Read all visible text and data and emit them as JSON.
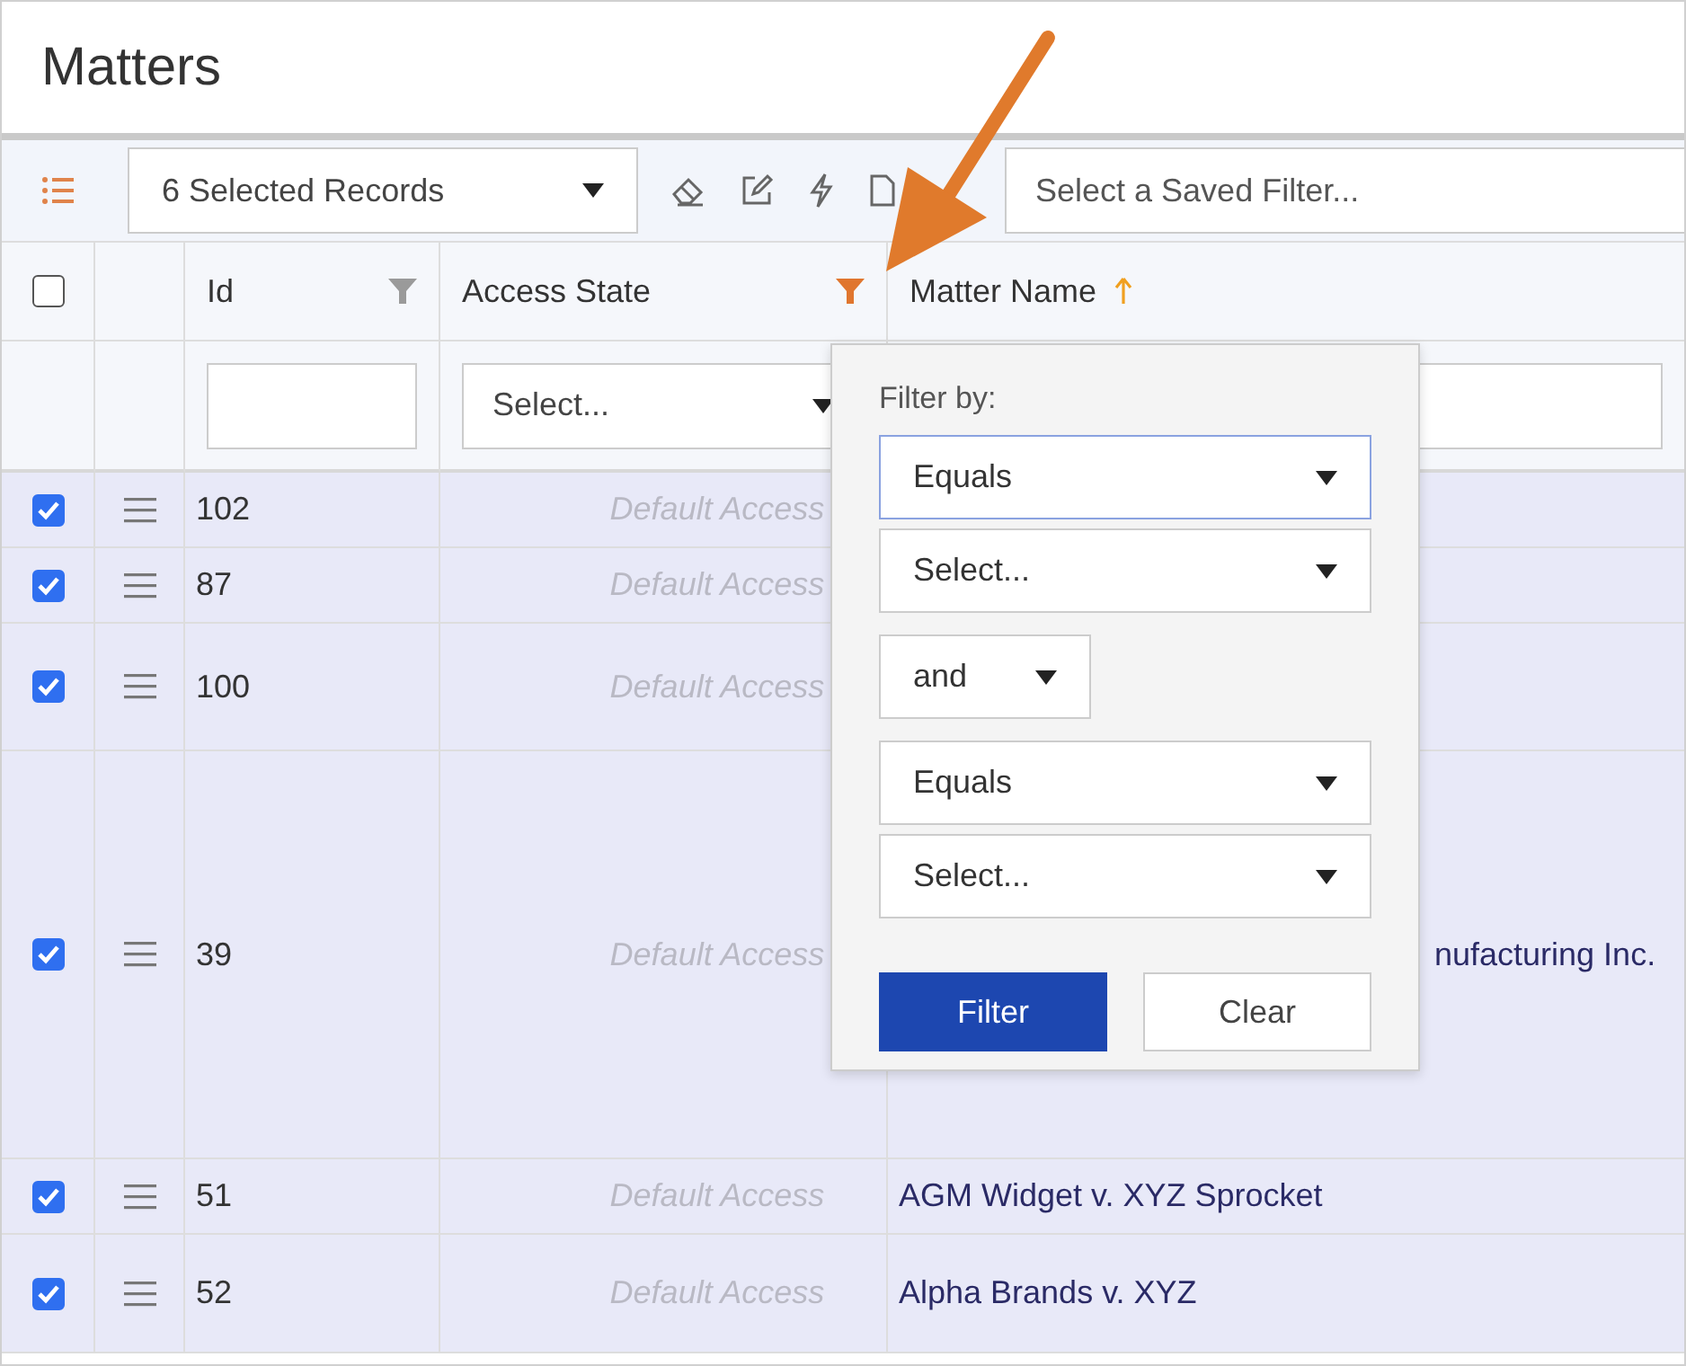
{
  "title": "Matters",
  "toolbar": {
    "records_select": "6 Selected Records",
    "saved_filter": {
      "placeholder": "Select a Saved Filter..."
    }
  },
  "header_checkbox": {
    "checked": false
  },
  "columns": [
    {
      "label": "Id",
      "filter_active": false
    },
    {
      "label": "Access State",
      "filter_active": true
    },
    {
      "label": "Matter Name",
      "sorted": true
    }
  ],
  "filter_row": {
    "access_select": "Select..."
  },
  "rows": [
    {
      "checked": true,
      "id": "102",
      "access": "Default Access"
    },
    {
      "checked": true,
      "id": "87",
      "access": "Default Access"
    },
    {
      "checked": true,
      "id": "100",
      "access": "Default Access"
    },
    {
      "checked": true,
      "id": "39",
      "access": "Default Access",
      "matter_name": "nufacturing Inc."
    },
    {
      "checked": true,
      "id": "51",
      "access": "Default Access",
      "matter_name": "AGM Widget v. XYZ Sprocket"
    },
    {
      "checked": true,
      "id": "52",
      "access": "Default Access",
      "matter_name": "Alpha Brands v. XYZ"
    }
  ],
  "filter_popup": {
    "label": "Filter by:",
    "condition_1": {
      "value": "Equals",
      "focused": true
    },
    "value_1": {
      "placeholder": "Select...",
      "focused": false
    },
    "joiner": "and",
    "condition_2": {
      "value": "Equals",
      "focused": false
    },
    "value_2": {
      "placeholder": "Select...",
      "focused": false
    },
    "buttons": [
      {
        "label": "Filter",
        "kind": "primary"
      },
      {
        "label": "Clear",
        "kind": "secondary"
      }
    ]
  }
}
